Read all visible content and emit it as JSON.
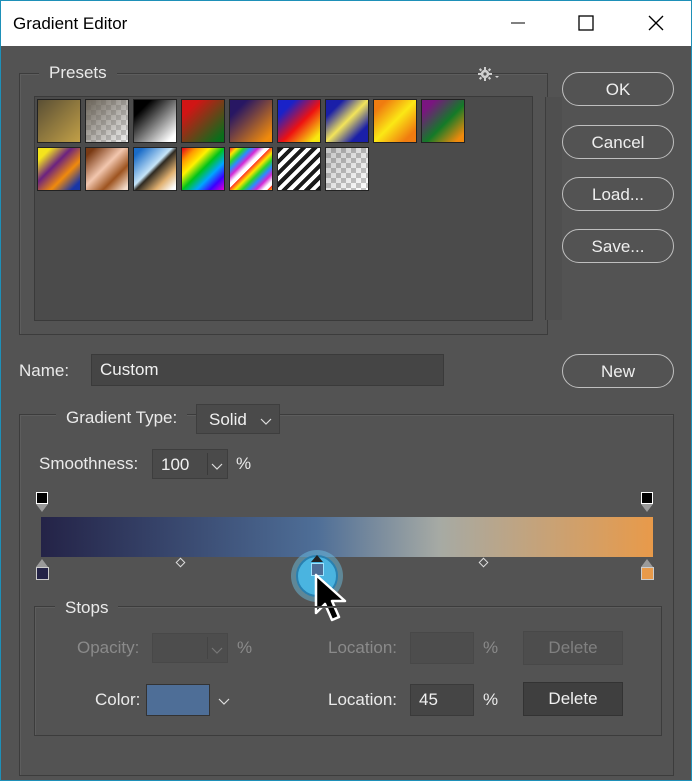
{
  "window": {
    "title": "Gradient Editor"
  },
  "presets": {
    "label": "Presets",
    "swatches": [
      {
        "name": "foreground-to-background",
        "css": "linear-gradient(135deg,#5a4f35 0%,#c2a047 100%)"
      },
      {
        "name": "foreground-to-transparent",
        "css": "linear-gradient(135deg,#6b6459 0%,rgba(200,200,200,0.2) 100%), repeating-conic-gradient(#c8c8c8 0% 25%, #fff 0% 50%) 0 0/10px 10px"
      },
      {
        "name": "black-white",
        "css": "linear-gradient(135deg,#000 20%,#fff 90%)"
      },
      {
        "name": "red-green",
        "css": "linear-gradient(135deg,#d01515 20%,#0a6e1b 90%)"
      },
      {
        "name": "violet-orange",
        "css": "linear-gradient(135deg,#281763 20%,#f08a0c 90%)"
      },
      {
        "name": "blue-red-yellow",
        "css": "linear-gradient(135deg,#1a22c8 20%,#e11 55%,#f8e910 90%)"
      },
      {
        "name": "blue-yellow-blue",
        "css": "linear-gradient(135deg,#1a1fa8 20%,#f2e45a 50%,#1a1fa8 80%)"
      },
      {
        "name": "orange-yellow-orange",
        "css": "linear-gradient(135deg,#f07c10 15%,#fbe815 50%,#f07c10 85%)"
      },
      {
        "name": "violet-green-orange",
        "css": "linear-gradient(135deg,#7a1580 15%,#137a28 55%,#f08a0c 90%)"
      },
      {
        "name": "yellow-violet-orange-blue",
        "css": "linear-gradient(135deg,#f4e41c 15%,#6b2280 40%,#f08a0c 65%,#1836a8 90%)"
      },
      {
        "name": "copper",
        "css": "linear-gradient(135deg,#7a3a14 10%,#f2c6ae 45%,#9e5420 70%,#f4dccb 95%)"
      },
      {
        "name": "chrome",
        "css": "linear-gradient(135deg,#1a6cc8 10%,#c6e4f8 45%,#2f2a22 52%,#e0b070 75%,#fff 95%)"
      },
      {
        "name": "spectrum",
        "css": "linear-gradient(135deg,#e3001b 0%,#ff9a00 17%,#fff200 33%,#00c41a 50%,#00a6ff 67%,#3a00ff 83%,#e300d0 100%)"
      },
      {
        "name": "transparent-rainbow",
        "css": "repeating-linear-gradient(135deg,#ff2a2a 0px,#ffe400 5px,#2ad42a 10px,#2a8cff 15px,#d42ad4 20px,#fff 25px,#fff 28px)"
      },
      {
        "name": "transparent-stripes",
        "css": "repeating-linear-gradient(135deg,#1a1a1a 0px,#1a1a1a 4px,#fff 4px,#fff 8px)"
      },
      {
        "name": "neutral-density",
        "css": "linear-gradient(135deg,rgba(60,60,60,0.3),rgba(255,255,255,0)), repeating-conic-gradient(#c8c8c8 0% 25%, #fff 0% 50%) 0 0/10px 10px"
      }
    ]
  },
  "buttons": {
    "ok": "OK",
    "cancel": "Cancel",
    "load": "Load...",
    "save": "Save...",
    "new": "New"
  },
  "name": {
    "label": "Name:",
    "value": "Custom"
  },
  "gradient": {
    "type_label": "Gradient Type:",
    "type_value": "Solid",
    "smoothness_label": "Smoothness:",
    "smoothness_value": "100",
    "percent": "%",
    "start_color": "#242347",
    "end_color": "#e89a4a",
    "selected_stop_color": "#4e6e97",
    "selected_stop_location_percent": 45
  },
  "stops": {
    "label": "Stops",
    "opacity_label": "Opacity:",
    "opacity_value": "",
    "percent": "%",
    "location_label": "Location:",
    "opacity_location_value": "",
    "delete_label": "Delete",
    "color_label": "Color:",
    "color_value": "#4e6e97",
    "color_location_value": "45"
  },
  "cursor": {
    "icon": "arrow-pointer-icon"
  }
}
